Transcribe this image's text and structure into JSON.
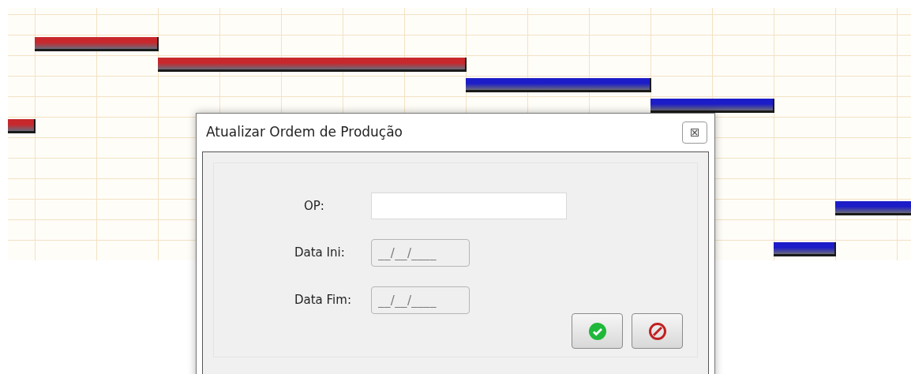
{
  "gantt": {
    "bars": [
      {
        "color": "#c8282c"
      },
      {
        "color": "#c8282c"
      },
      {
        "color": "#1c1cc8"
      },
      {
        "color": "#1c1cc8"
      },
      {
        "color": "#c8282c"
      },
      {
        "color": "#1c1cc8"
      },
      {
        "color": "#1c1cc8"
      }
    ]
  },
  "dialog": {
    "title": "Atualizar Ordem de Produção",
    "fields": [
      {
        "kind": "text",
        "label": "OP:"
      },
      {
        "kind": "date",
        "label": "Data Ini:",
        "value": "__/__/____"
      },
      {
        "kind": "date",
        "label": "Data Fim:",
        "value": "__/__/____"
      }
    ],
    "buttons": [
      {
        "kind": "confirm"
      },
      {
        "kind": "cancel"
      }
    ]
  }
}
